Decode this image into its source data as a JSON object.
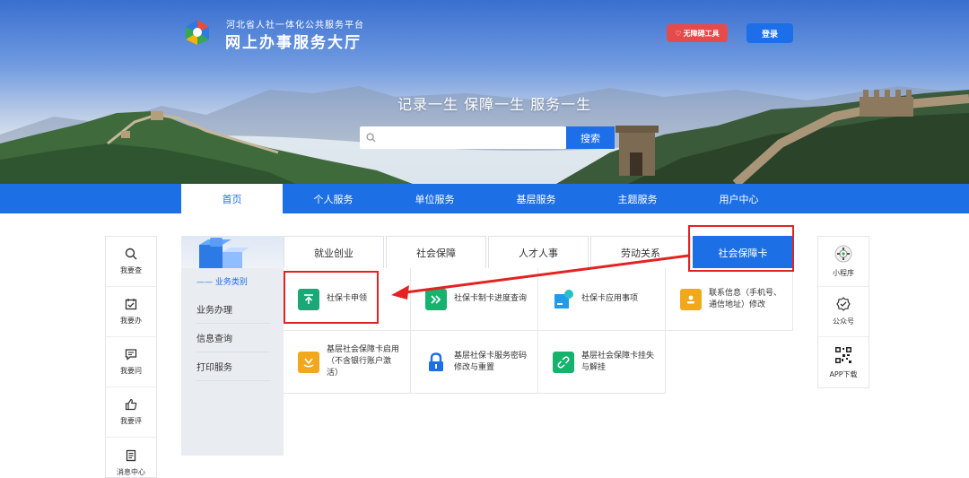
{
  "header": {
    "org_line1": "河北省人社一体化公共服务平台",
    "org_line2": "网上办事服务大厅",
    "accessibility_label": "无障碍工具",
    "login_label": "登录"
  },
  "banner": {
    "slogan": "记录一生 保障一生 服务一生",
    "search_placeholder": "",
    "search_button": "搜索"
  },
  "nav": {
    "items": [
      {
        "label": "首页"
      },
      {
        "label": "个人服务"
      },
      {
        "label": "单位服务"
      },
      {
        "label": "基层服务"
      },
      {
        "label": "主题服务"
      },
      {
        "label": "用户中心"
      }
    ]
  },
  "left_float": {
    "items": [
      {
        "label": "我要查",
        "icon": "search-icon"
      },
      {
        "label": "我要办",
        "icon": "calendar-check-icon"
      },
      {
        "label": "我要问",
        "icon": "chat-icon"
      },
      {
        "label": "我要评",
        "icon": "thumbs-up-icon"
      },
      {
        "label": "消息中心",
        "icon": "document-icon"
      }
    ]
  },
  "right_float": {
    "items": [
      {
        "label": "小程序",
        "icon": "mini-program-qr-icon"
      },
      {
        "label": "公众号",
        "icon": "verified-icon"
      },
      {
        "label": "APP下载",
        "icon": "qr-code-icon"
      }
    ]
  },
  "category": {
    "heading": "—— 业务类别",
    "items": [
      "业务办理",
      "信息查询",
      "打印服务"
    ]
  },
  "tabs": [
    {
      "label": "就业创业"
    },
    {
      "label": "社会保障"
    },
    {
      "label": "人才人事"
    },
    {
      "label": "劳动关系"
    },
    {
      "label": "社会保障卡"
    }
  ],
  "services": [
    {
      "label": "社保卡申领",
      "color": "#1aa877",
      "icon": "upload-arrow-icon"
    },
    {
      "label": "社保卡制卡进度查询",
      "color": "#16b36e",
      "icon": "double-chevron-icon"
    },
    {
      "label": "社保卡应用事项",
      "color": "#1f9be8",
      "icon": "card-pin-icon"
    },
    {
      "label": "联系信息（手机号、通信地址）修改",
      "color": "#f2a81d",
      "icon": "contact-card-icon"
    },
    {
      "label": "基层社会保障卡启用（不含银行账户激活）",
      "color": "#f2a81d",
      "icon": "shield-enable-icon"
    },
    {
      "label": "基层社保卡服务密码修改与重置",
      "color": "#1d6fe6",
      "icon": "lock-icon"
    },
    {
      "label": "基层社会保障卡挂失与解挂",
      "color": "#16b36e",
      "icon": "link-icon"
    }
  ],
  "colors": {
    "primary": "#1d6fe6",
    "annotation": "#e52222",
    "accessibility": "#e64b4b"
  }
}
